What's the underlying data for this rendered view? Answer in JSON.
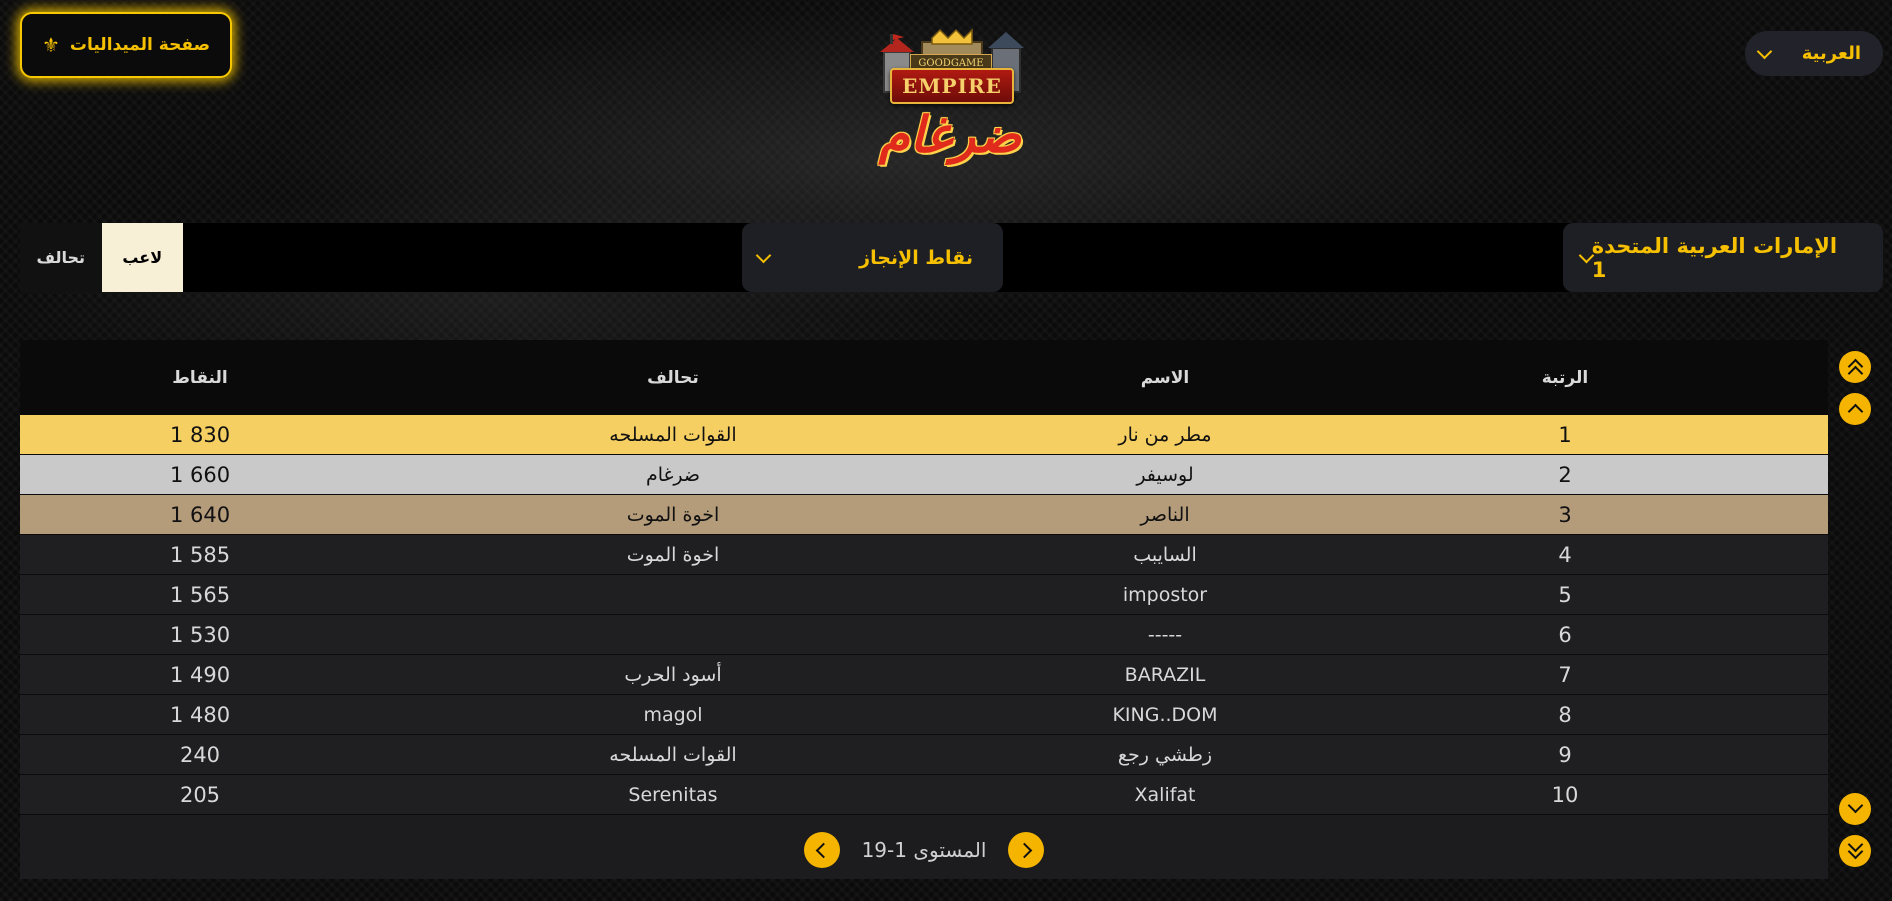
{
  "header": {
    "medals_button": "صفحة الميداليات",
    "medals_icon": "fleur-de-lis-icon",
    "language": "العربية",
    "logo": {
      "goodgame": "GOODGAME",
      "empire": "EMPIRE",
      "clan_name": "ضرغام"
    }
  },
  "controls": {
    "toggle": {
      "player": "لاعب",
      "alliance": "تحالف",
      "selected": "player"
    },
    "category": "نقاط الإنجاز",
    "server": "الإمارات العربية المتحدة 1"
  },
  "table": {
    "headers": {
      "rank": "الرتبة",
      "name": "الاسم",
      "alliance": "تحالف",
      "points": "النقاط"
    },
    "rows": [
      {
        "rank": "1",
        "name": "مطر من نار",
        "alliance": "القوات المسلحه",
        "points": "1 830"
      },
      {
        "rank": "2",
        "name": "لوسيفر",
        "alliance": "ضرغام",
        "points": "1 660"
      },
      {
        "rank": "3",
        "name": "الناصر",
        "alliance": "اخوة الموت",
        "points": "1 640"
      },
      {
        "rank": "4",
        "name": "السايبب",
        "alliance": "اخوة الموت",
        "points": "1 585"
      },
      {
        "rank": "5",
        "name": "impostor",
        "alliance": "",
        "points": "1 565"
      },
      {
        "rank": "6",
        "name": "-----",
        "alliance": "",
        "points": "1 530"
      },
      {
        "rank": "7",
        "name": "BARAZIL",
        "alliance": "أسود الحرب",
        "points": "1 490"
      },
      {
        "rank": "8",
        "name": "KING..DOM",
        "alliance": "magol",
        "points": "1 480"
      },
      {
        "rank": "9",
        "name": "زطشي رجع",
        "alliance": "القوات المسلحه",
        "points": "240"
      },
      {
        "rank": "10",
        "name": "Xalifat",
        "alliance": "Serenitas",
        "points": "205"
      }
    ],
    "podium_colors": {
      "gold": "#f6cf62",
      "silver": "#c9c9c9",
      "bronze": "#b49b7a"
    }
  },
  "pagination": {
    "label": "المستوى 1-19"
  },
  "colors": {
    "accent": "#f6c000",
    "button": "#f4b400"
  }
}
